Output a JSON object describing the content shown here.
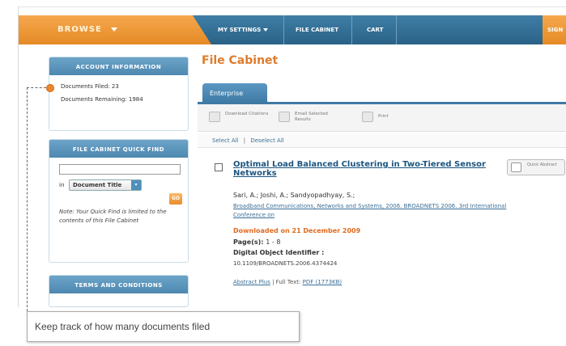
{
  "nav": {
    "browse": "BROWSE",
    "my_settings": "MY SETTINGS",
    "file_cabinet": "FILE CABINET",
    "cart": "CART",
    "right_item": "SIGN"
  },
  "account": {
    "heading": "ACCOUNT INFORMATION",
    "documents_filed": "Documents Filed: 23",
    "documents_remaining": "Documents Remaining: 1984"
  },
  "quick_find": {
    "heading": "FILE CABINET QUICK FIND",
    "search_value": "",
    "in_label": "in",
    "select_value": "Document Title",
    "go_label": "GO",
    "note": "Note: Your Quick Find is limited to the contents of this File Cabinet"
  },
  "terms": {
    "heading": "TERMS AND CONDITIONS"
  },
  "main": {
    "title": "File Cabinet",
    "tab": "Enterprise",
    "tools": {
      "download": "Download Citations",
      "email": "Email Selected Results",
      "print": "Print"
    },
    "select_all": "Select All",
    "deselect_all": "Deselect All",
    "separator": "|"
  },
  "result": {
    "title": "Optimal Load Balanced Clustering in Two-Tiered Sensor Networks",
    "quick_abstract": "Quick Abstract",
    "authors": "Sari, A.;  Joshi, A.;  Sandyopadhyay, S.;",
    "publication": "Broadband Communications, Networks and Systems, 2006. BROADNETS 2006. 3rd International Conference on",
    "downloaded": "Downloaded on 21 December 2009",
    "pages_label": "Page(s):",
    "pages_value": "1 - 8",
    "doi_label": "Digital Object Identifier :",
    "doi_value": "10.1109/BROADNETS.2006.4374424",
    "abstract_plus": "Abstract Plus",
    "full_text_label": "| Full Text:",
    "pdf_link": "PDF (1773KB)"
  },
  "annotation": {
    "text": "Keep track of how many documents filed"
  },
  "colors": {
    "brand_orange": "#e48a25",
    "nav_blue": "#2a6286",
    "title_orange": "#e07b2a",
    "link_blue": "#1c5580"
  }
}
